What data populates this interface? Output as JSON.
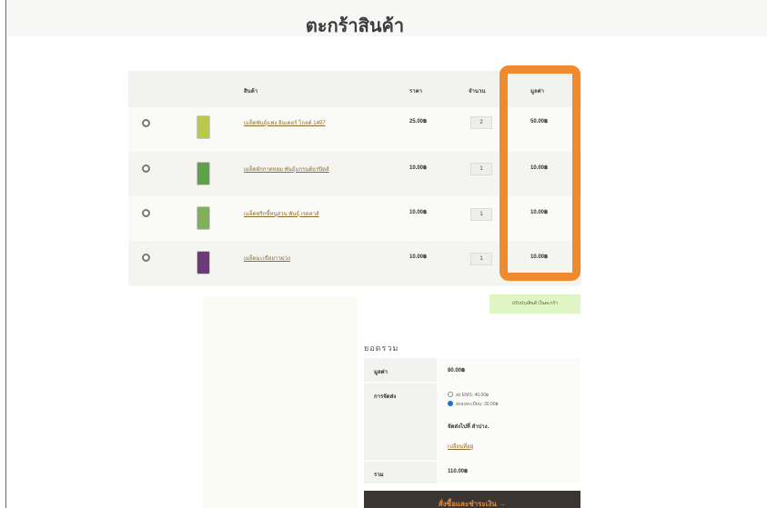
{
  "page": {
    "title": "ตะกร้าสินค้า"
  },
  "cart": {
    "headers": {
      "product": "สินค้า",
      "price": "ราคา",
      "quantity": "จำนวน",
      "subtotal": "มูลค่า"
    },
    "items": [
      {
        "name": "เมล็ดพันธุ์แฟง อินเตอร์ โกลด์ 1497",
        "price": "25.00฿",
        "qty": "2",
        "subtotal": "50.00฿",
        "thumb_color": "#b9c94a"
      },
      {
        "name": "เมล็ดผักกาดหอม พันธุ์แกรนด์แรปิดส์",
        "price": "10.00฿",
        "qty": "1",
        "subtotal": "10.00฿",
        "thumb_color": "#5fa04a"
      },
      {
        "name": "เมล็ดพริกขี้หนูสวน พันธุ์ เรดลาส์",
        "price": "10.00฿",
        "qty": "1",
        "subtotal": "10.00฿",
        "thumb_color": "#7fb05a"
      },
      {
        "name": "เมล็ดมะเขือยาวม่วง",
        "price": "10.00฿",
        "qty": "1",
        "subtotal": "10.00฿",
        "thumb_color": "#6a3a7a"
      }
    ],
    "update_button": "ปรับปรุงสินค้าในตะกร้า",
    "highlight_color": "#f08a2f"
  },
  "totals": {
    "title": "ยอดรวม",
    "subtotal_label": "มูลค่า",
    "subtotal_value": "80.00฿",
    "shipping_label": "การจัดส่ง",
    "shipping_options": [
      {
        "label": "ส่ง EMS: 40.00฿",
        "selected": false
      },
      {
        "label": "ส่งลงทะเบียน: 30.00฿",
        "selected": true
      }
    ],
    "ship_to": "จัดส่งไปที่ ลำปาง.",
    "change_address": "เปลี่ยนที่อยู่",
    "total_label": "รวม",
    "total_value": "110.00฿",
    "checkout_button": "สั่งซื้อและชำระเงิน →"
  }
}
